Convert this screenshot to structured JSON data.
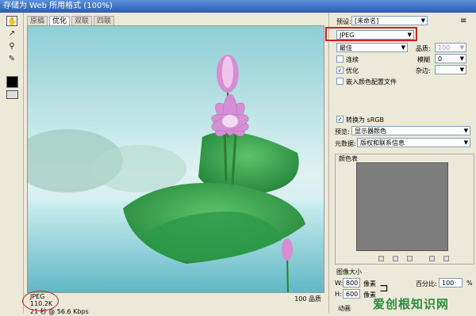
{
  "window": {
    "title": "存储为 Web 所用格式 (100%)"
  },
  "tabs": [
    "原稿",
    "优化",
    "双联",
    "四联"
  ],
  "image": {
    "alt": "lotus"
  },
  "info": {
    "format": "JPEG",
    "size": "110.2K",
    "time": "21 秒 @ 56.6 Kbps",
    "quality_status": "100 品质"
  },
  "settings": {
    "preset_label": "预设:",
    "preset_value": "[未命名]",
    "format": "JPEG",
    "quality_level": "最佳",
    "quality_label": "品质:",
    "quality_value": "100",
    "progressive": "连续",
    "blur_label": "模糊",
    "blur_value": "0",
    "optimized": "优化",
    "matte_label": "杂边:",
    "embed_profile": "嵌入颜色配置文件",
    "convert_srgb": "转换为 sRGB",
    "preview_label": "预览:",
    "preview_value": "显示器颜色",
    "metadata_label": "元数据:",
    "metadata_value": "版权和联系信息",
    "color_table": "颜色表",
    "image_size": "图像大小",
    "w_label": "W:",
    "w_value": "800",
    "h_label": "H:",
    "h_value": "600",
    "unit": "像素",
    "percent_label": "百分比:",
    "percent_value": "100",
    "percent_unit": "%",
    "animation": "动画"
  },
  "watermark": "爱创根知识网",
  "colors": {
    "accent": "#d02020",
    "watermark": "#2a8b3c"
  }
}
